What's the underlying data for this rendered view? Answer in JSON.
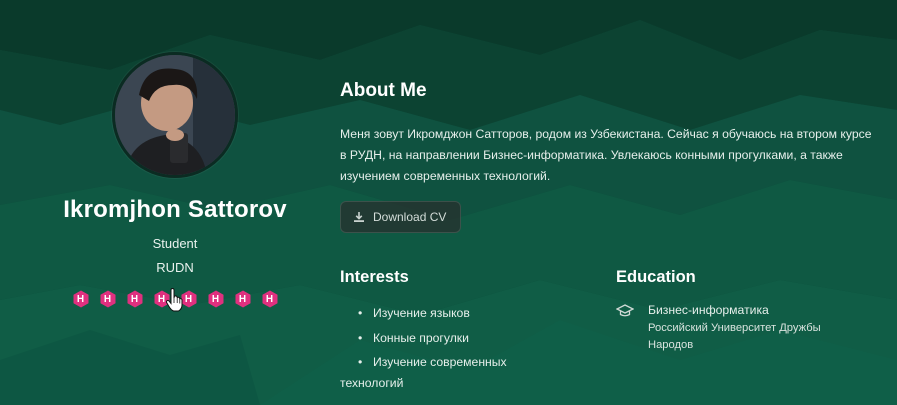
{
  "profile": {
    "name": "Ikromjhon Sattorov",
    "role": "Student",
    "organization": "RUDN",
    "badges": [
      "H",
      "H",
      "H",
      "H",
      "H",
      "H",
      "H",
      "H"
    ]
  },
  "about": {
    "title": "About Me",
    "text": "Меня зовут Икромджон Сатторов, родом из Узбекистана. Сейчас я обучаюсь на втором курсе в РУДН, на направлении Бизнес-информатика. Увлекаюсь конными прогулками, а также изучением современных технологий.",
    "download_label": "Download CV"
  },
  "interests": {
    "title": "Interests",
    "items": [
      "Изучение языков",
      "Конные прогулки",
      "Изучение современных технологий"
    ]
  },
  "education": {
    "title": "Education",
    "degree": "Бизнес-информатика",
    "school": "Российский Университет Дружбы Народов"
  },
  "colors": {
    "background_dark": "#0b3a2b",
    "background_mid": "#0f5a42",
    "badge": "#e0307f",
    "button_bg": "#2f3634",
    "text": "#ffffff"
  },
  "icons": [
    "download-icon",
    "graduation-cap-icon",
    "hand-pointer-icon"
  ]
}
